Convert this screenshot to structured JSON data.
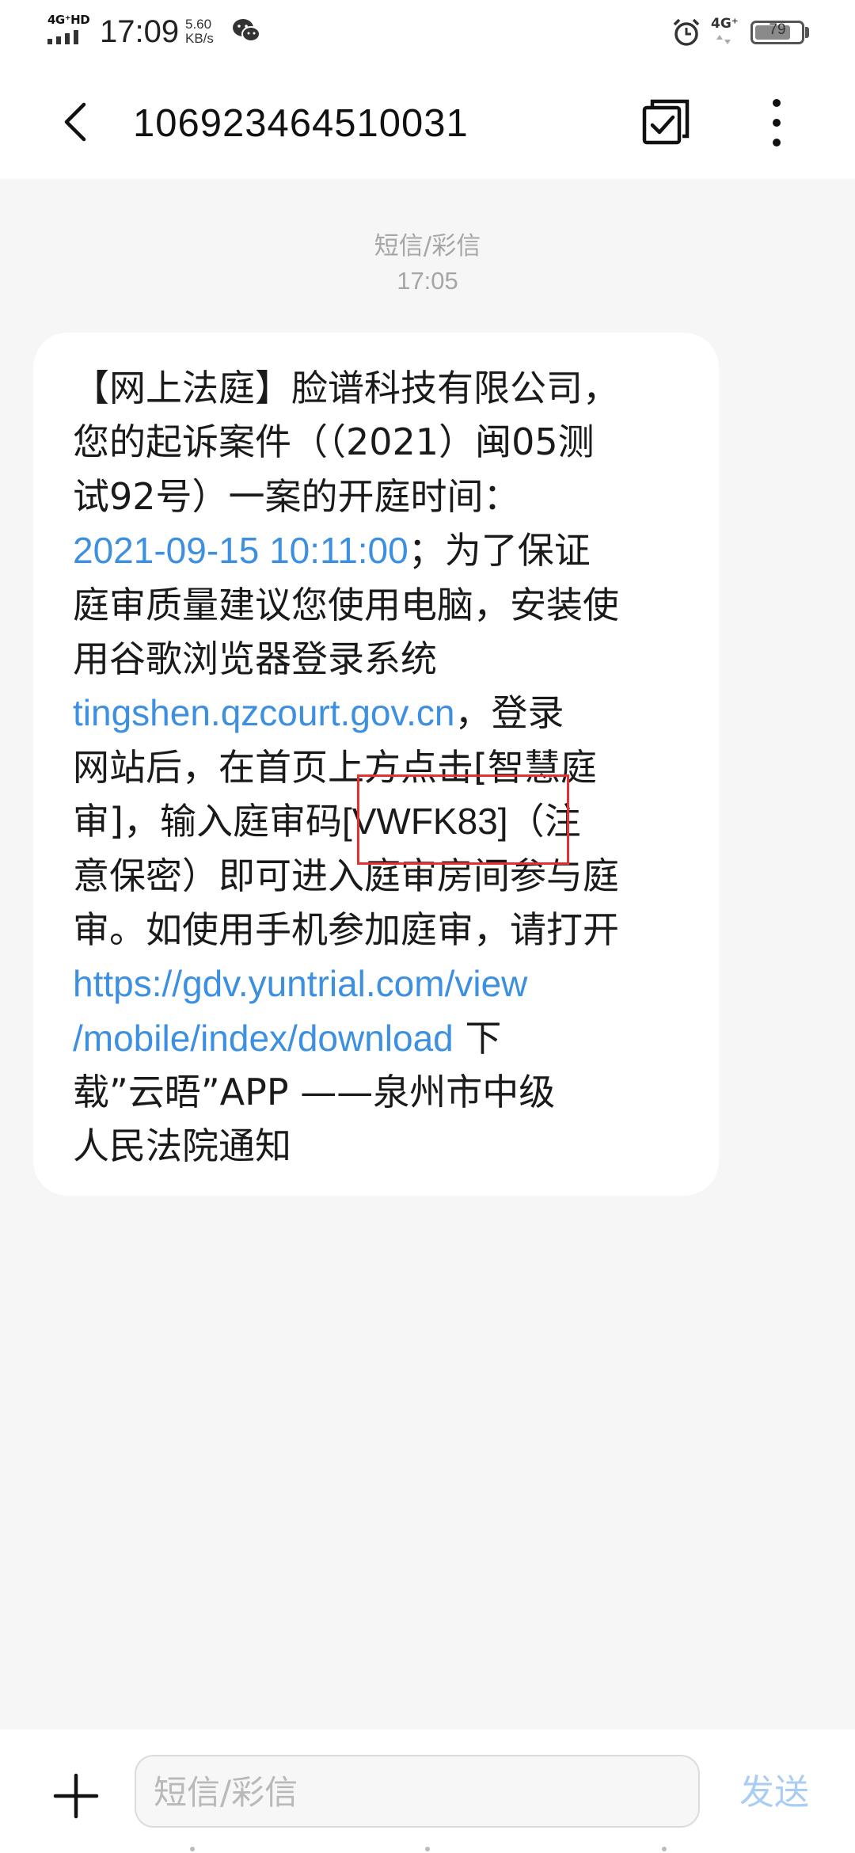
{
  "status_bar": {
    "network_label": "4G⁺HD",
    "time": "17:09",
    "speed_value": "5.60",
    "speed_unit": "KB/s",
    "network_right": "4G⁺",
    "battery": "79",
    "battery_level": 0.79
  },
  "header": {
    "title": "106923464510031",
    "icons": [
      "back-arrow-icon",
      "multi-select-icon",
      "more-vertical-icon"
    ]
  },
  "conversation": {
    "message_type": "短信/彩信",
    "time": "17:05",
    "message_lines": [
      {
        "parts": [
          {
            "text": "【网上法庭】脸谱科技有限公司，",
            "kind": "text"
          }
        ]
      },
      {
        "parts": [
          {
            "text": "您的起诉案件（（2021）闽05测",
            "kind": "text"
          }
        ]
      },
      {
        "parts": [
          {
            "text": "试92号）一案的开庭时间：",
            "kind": "text"
          }
        ]
      },
      {
        "parts": [
          {
            "text": "2021-09-15 10:11:00",
            "kind": "link"
          },
          {
            "text": "；为了保证",
            "kind": "text"
          }
        ]
      },
      {
        "parts": [
          {
            "text": "庭审质量建议您使用电脑，安装使",
            "kind": "text"
          }
        ]
      },
      {
        "parts": [
          {
            "text": "用谷歌浏览器登录系统",
            "kind": "text"
          }
        ]
      },
      {
        "parts": [
          {
            "text": "tingshen.qzcourt.gov.cn",
            "kind": "link"
          },
          {
            "text": "，登录",
            "kind": "text"
          }
        ]
      },
      {
        "parts": [
          {
            "text": "网站后，在首页上方点击[智慧庭",
            "kind": "text"
          }
        ]
      },
      {
        "parts": [
          {
            "text": "审]，输入庭审码",
            "kind": "text"
          },
          {
            "text": "[VWFK83]",
            "kind": "latin"
          },
          {
            "text": "（注",
            "kind": "text"
          }
        ]
      },
      {
        "parts": [
          {
            "text": "意保密）即可进入庭审房间参与庭",
            "kind": "text"
          }
        ]
      },
      {
        "parts": [
          {
            "text": "审。如使用手机参加庭审，请打开",
            "kind": "text"
          }
        ]
      },
      {
        "parts": [
          {
            "text": "https://gdv.yuntrial.com/view",
            "kind": "link"
          }
        ]
      },
      {
        "parts": [
          {
            "text": "/mobile/index/download",
            "kind": "link"
          },
          {
            "text": " 下",
            "kind": "text"
          }
        ]
      },
      {
        "parts": [
          {
            "text": "载”云晤”APP ——泉州市中级",
            "kind": "text"
          }
        ]
      },
      {
        "parts": [
          {
            "text": "人民法院通知",
            "kind": "text"
          }
        ]
      }
    ]
  },
  "input_bar": {
    "placeholder": "短信/彩信",
    "send_label": "发送"
  },
  "colors": {
    "link": "#3d8fe0",
    "highlight_border": "#e5312f",
    "send_disabled": "#a9cdf3",
    "background": "#f6f6f6"
  }
}
